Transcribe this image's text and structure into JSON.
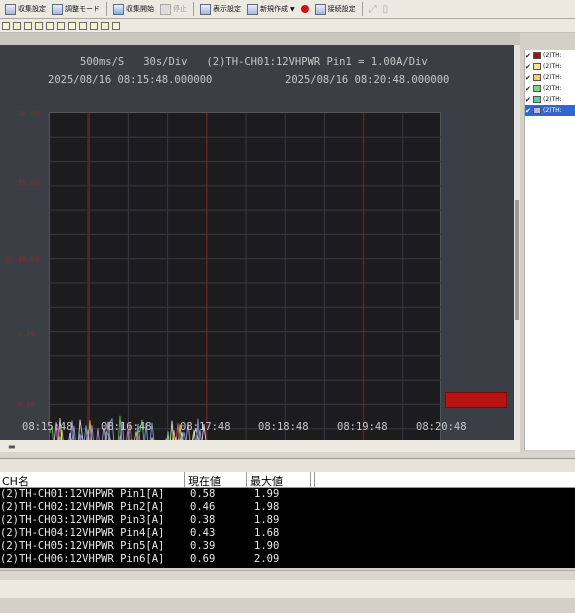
{
  "toolbar": {
    "items": [
      {
        "label": "収集設定",
        "icon": "settings-icon"
      },
      {
        "label": "調整モード",
        "icon": "adjust-icon"
      },
      {
        "label": "収集開始",
        "icon": "play-icon"
      },
      {
        "label": "停止",
        "icon": "stop-icon"
      },
      {
        "label": "表示設定",
        "icon": "display-icon"
      },
      {
        "label": "新規作成",
        "icon": "new-icon"
      },
      {
        "label": "接続設定",
        "icon": "connect-icon"
      }
    ]
  },
  "chart_window": {
    "header_line1": "500ms/S   30s/Div   (2)TH-CH01:12VHPWR Pin1 = 1.00A/Div",
    "header_left_date": "2025/08/16 08:15:48.000000",
    "header_right_date": "2025/08/16 08:20:48.000000"
  },
  "chart_data": {
    "type": "line",
    "x_labels": [
      "08:15:48",
      "08:16:48",
      "08:17:48",
      "08:18:48",
      "08:19:48",
      "08:20:48"
    ],
    "series_colors": [
      "#e8e36a",
      "#f5f5f5",
      "#6ad36a",
      "#e06a6a",
      "#8ab8f0",
      "#c8a8f0"
    ],
    "accent_color": "#b81414"
  },
  "legend": {
    "items": [
      {
        "color": "#8b1a1a",
        "label": "(2)TH:"
      },
      {
        "color": "#f0e68c",
        "label": "(2)TH:"
      },
      {
        "color": "#f2d06a",
        "label": "(2)TH:"
      },
      {
        "color": "#7ad87a",
        "label": "(2)TH:"
      },
      {
        "color": "#5ed0a0",
        "label": "(2)TH:"
      },
      {
        "color": "#b8b8e8",
        "label": "(2)TH:"
      }
    ]
  },
  "table": {
    "headers": {
      "name": "CH名",
      "current": "現在値",
      "max": "最大値"
    },
    "rows": [
      {
        "name": "(2)TH-CH01:12VHPWR Pin1[A]",
        "current": "0.58",
        "max": "1.99"
      },
      {
        "name": "(2)TH-CH02:12VHPWR Pin2[A]",
        "current": "0.46",
        "max": "1.98"
      },
      {
        "name": "(2)TH-CH03:12VHPWR Pin3[A]",
        "current": "0.38",
        "max": "1.89"
      },
      {
        "name": "(2)TH-CH04:12VHPWR Pin4[A]",
        "current": "0.43",
        "max": "1.68"
      },
      {
        "name": "(2)TH-CH05:12VHPWR Pin5[A]",
        "current": "0.39",
        "max": "1.90"
      },
      {
        "name": "(2)TH-CH06:12VHPWR Pin6[A]",
        "current": "0.69",
        "max": "2.09"
      }
    ]
  }
}
